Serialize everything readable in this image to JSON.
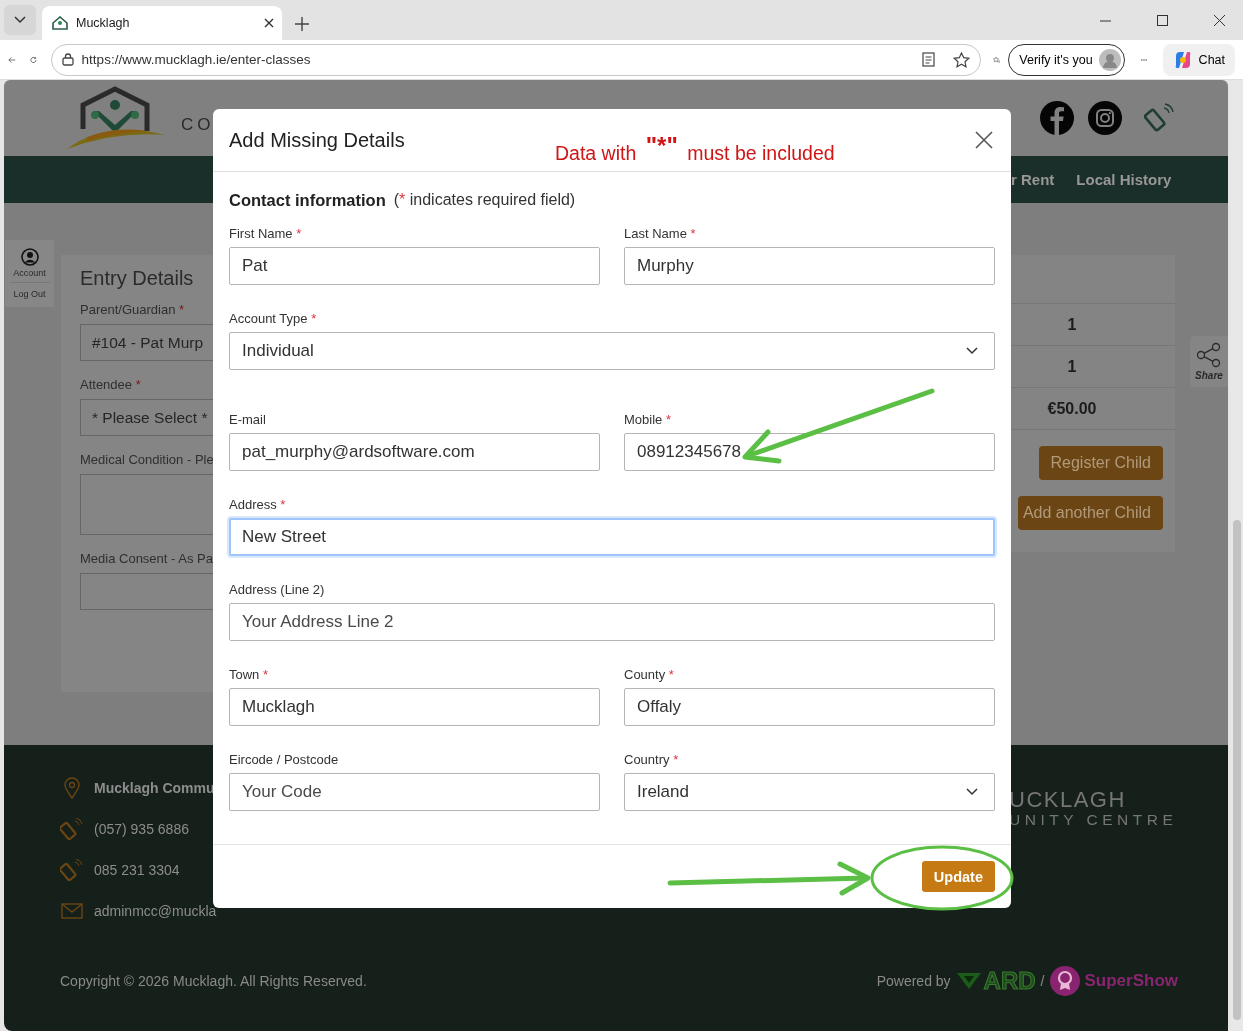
{
  "browser": {
    "tab_title": "Mucklagh",
    "url": "https://www.mucklagh.ie/enter-classes",
    "profile_button": "Verify it's you",
    "chat_button": "Chat"
  },
  "site": {
    "logo_text": "CO",
    "nav": [
      "r Rent",
      "Local History"
    ],
    "sidebar": [
      "Account",
      "Log Out"
    ],
    "entry": {
      "title": "Entry Details",
      "fields": [
        {
          "label": "Parent/Guardian",
          "required_mark": "*",
          "kind": "select",
          "value": "#104 - Pat Murp"
        },
        {
          "label": "Attendee",
          "required_mark": "*",
          "kind": "select",
          "value": "* Please Select *"
        },
        {
          "label": "Medical Condition - Ple",
          "kind": "textarea"
        },
        {
          "label": "Media Consent - As Pa",
          "kind": "text"
        }
      ]
    },
    "summary": {
      "rows": [
        "1",
        "1",
        "€50.00"
      ],
      "buttons": [
        "Register Child",
        "Add another Child"
      ]
    },
    "share": "Share",
    "footer": {
      "contacts": [
        {
          "kind": "address",
          "text": "Mucklagh Commu"
        },
        {
          "kind": "phone",
          "text": "(057) 935 6886"
        },
        {
          "kind": "phone",
          "text": "085 231 3304"
        },
        {
          "kind": "email",
          "text": "adminmcc@muckla"
        }
      ],
      "brand": [
        "UCKLAGH",
        "UNITY CENTRE"
      ],
      "copyright": "Copyright © 2026 Mucklagh. All Rights Reserved.",
      "powered_by": "Powered by",
      "partners": [
        "ARD",
        "/",
        "SuperShow"
      ]
    }
  },
  "modal": {
    "title": "Add Missing Details",
    "section": "Contact information",
    "note": [
      "(",
      "*",
      " indicates required field)"
    ],
    "rows": [
      {
        "fields": [
          {
            "label": "First Name",
            "required_mark": "*",
            "kind": "text",
            "value": "Pat",
            "focused": false
          },
          {
            "label": "Last Name",
            "required_mark": "*",
            "kind": "text",
            "value": "Murphy",
            "focused": false
          }
        ]
      },
      {
        "fields": [
          {
            "label": "Account Type",
            "required_mark": "*",
            "kind": "select",
            "value": "Individual",
            "focused": false
          }
        ]
      },
      {
        "fields": [
          {
            "label": "E-mail",
            "kind": "text",
            "value": "pat_murphy@ardsoftware.com",
            "focused": false
          },
          {
            "label": "Mobile",
            "required_mark": "*",
            "kind": "text",
            "value": "08912345678",
            "focused": false
          }
        ]
      },
      {
        "fields": [
          {
            "label": "Address",
            "required_mark": "*",
            "kind": "text",
            "value": "New Street",
            "focused": true
          }
        ]
      },
      {
        "fields": [
          {
            "label": "Address (Line 2)",
            "kind": "text",
            "placeholder": "Your Address Line 2",
            "focused": false
          }
        ]
      },
      {
        "fields": [
          {
            "label": "Town",
            "required_mark": "*",
            "kind": "text",
            "value": "Mucklagh",
            "focused": false
          },
          {
            "label": "County",
            "required_mark": "*",
            "kind": "text",
            "value": "Offaly",
            "focused": false
          }
        ]
      },
      {
        "fields": [
          {
            "label": "Eircode / Postcode",
            "kind": "text",
            "placeholder": "Your Code",
            "focused": false
          },
          {
            "label": "Country",
            "required_mark": "*",
            "kind": "select",
            "value": "Ireland",
            "focused": false
          }
        ]
      }
    ],
    "submit": "Update"
  },
  "annotation": {
    "note": "Data with **\"*\"** must be included"
  }
}
